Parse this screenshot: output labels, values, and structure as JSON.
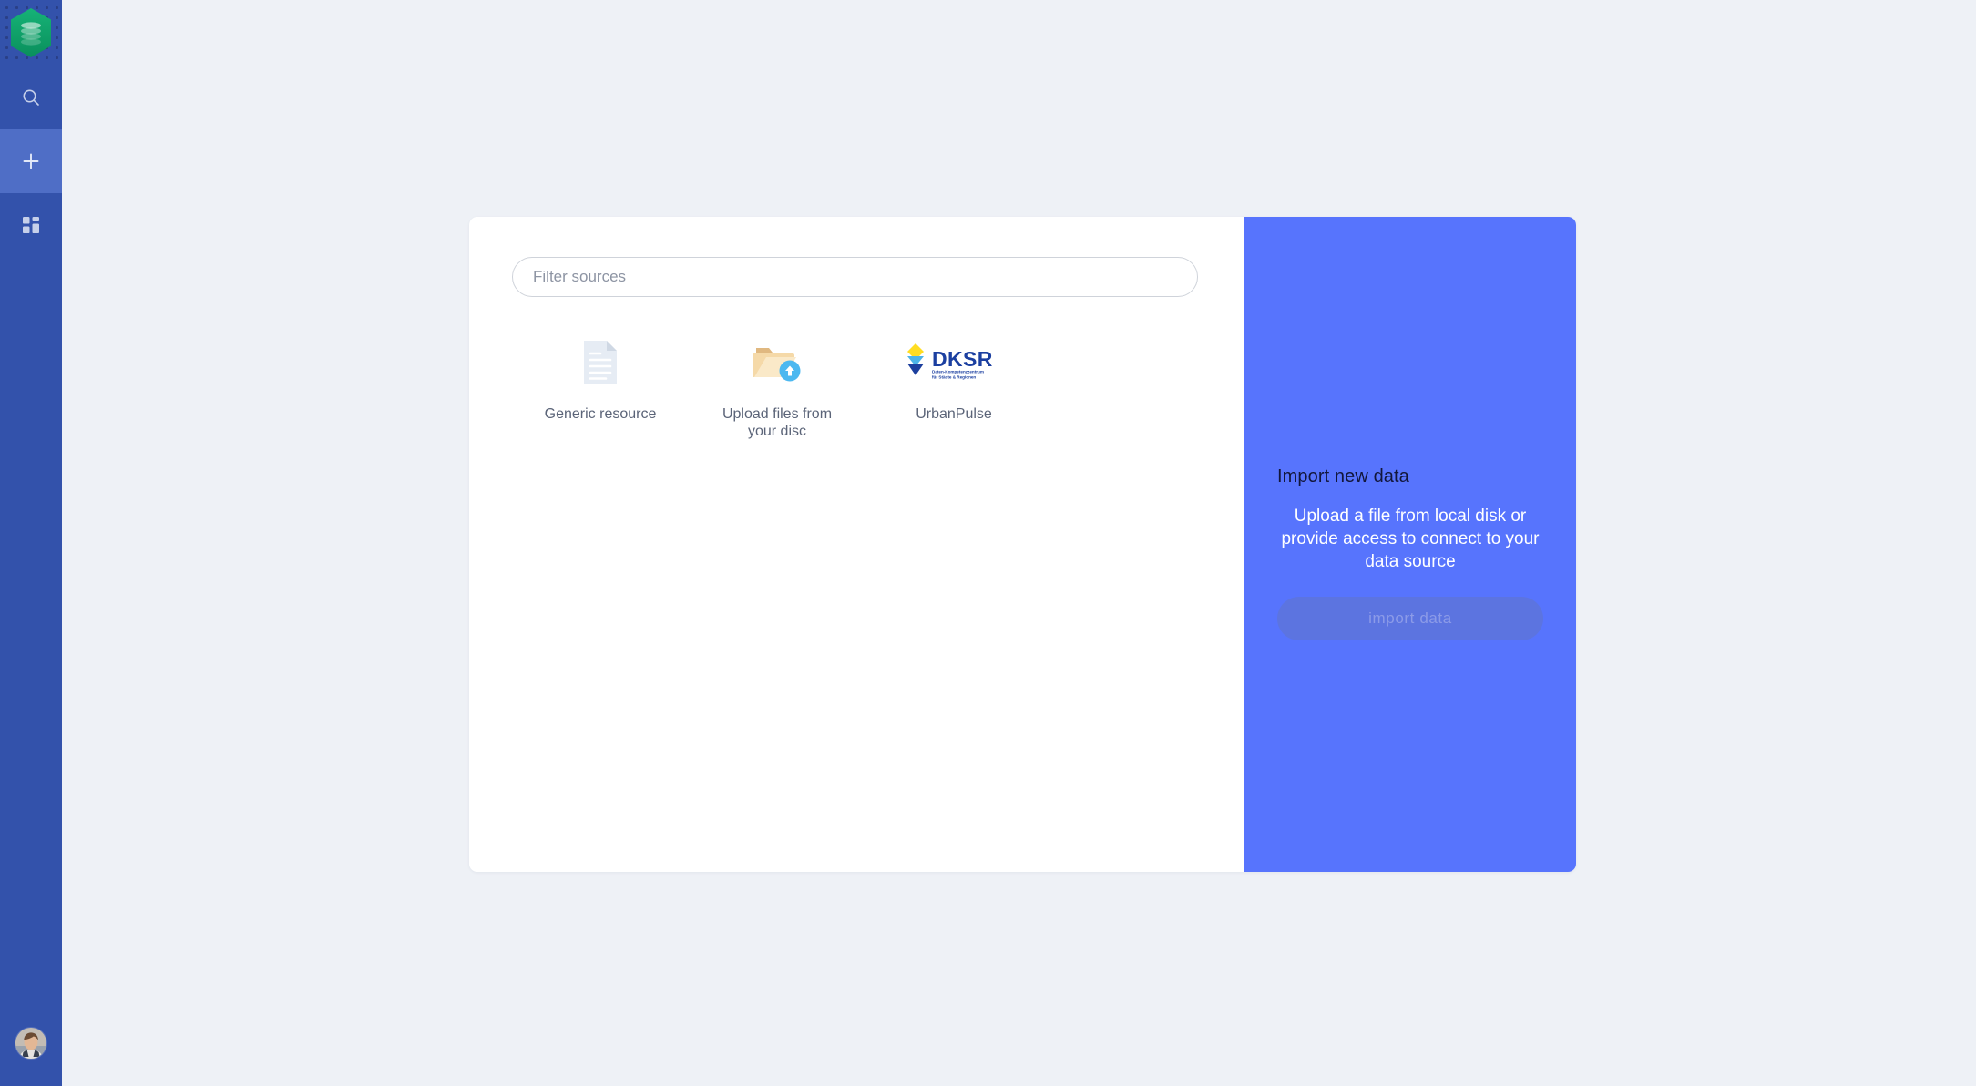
{
  "sidebar": {
    "logo": {
      "icon": "layers-hexagon-logo",
      "color": "#10a36a"
    },
    "items": [
      {
        "id": "search",
        "icon": "search-icon",
        "active": false
      },
      {
        "id": "add",
        "icon": "plus-icon",
        "active": true
      },
      {
        "id": "dashboard",
        "icon": "grid-icon",
        "active": false
      }
    ],
    "avatar": {
      "icon": "user-avatar",
      "alt": "User profile photo"
    },
    "background_color": "#3352ab",
    "active_color": "#4f6ec6"
  },
  "card": {
    "filter": {
      "placeholder": "Filter sources",
      "value": ""
    },
    "sources": [
      {
        "id": "generic-resource",
        "label": "Generic resource",
        "icon": "document-icon"
      },
      {
        "id": "upload-files",
        "label": "Upload files from your disc",
        "icon": "folder-upload-icon"
      },
      {
        "id": "urbanpulse",
        "label": "UrbanPulse",
        "icon": "dksr-logo"
      }
    ],
    "dksr": {
      "wordmark": "DKSR",
      "tagline_line1": "Daten-Kompetenzzentrum",
      "tagline_line2": "für Städte & Regionen"
    },
    "panel": {
      "title": "Import new data",
      "description": "Upload a file from local disk or provide access to connect to your data source",
      "button_label": "import data",
      "button_disabled": true,
      "background_color": "#5774fd"
    }
  },
  "page": {
    "background_color": "#eef1f6"
  }
}
